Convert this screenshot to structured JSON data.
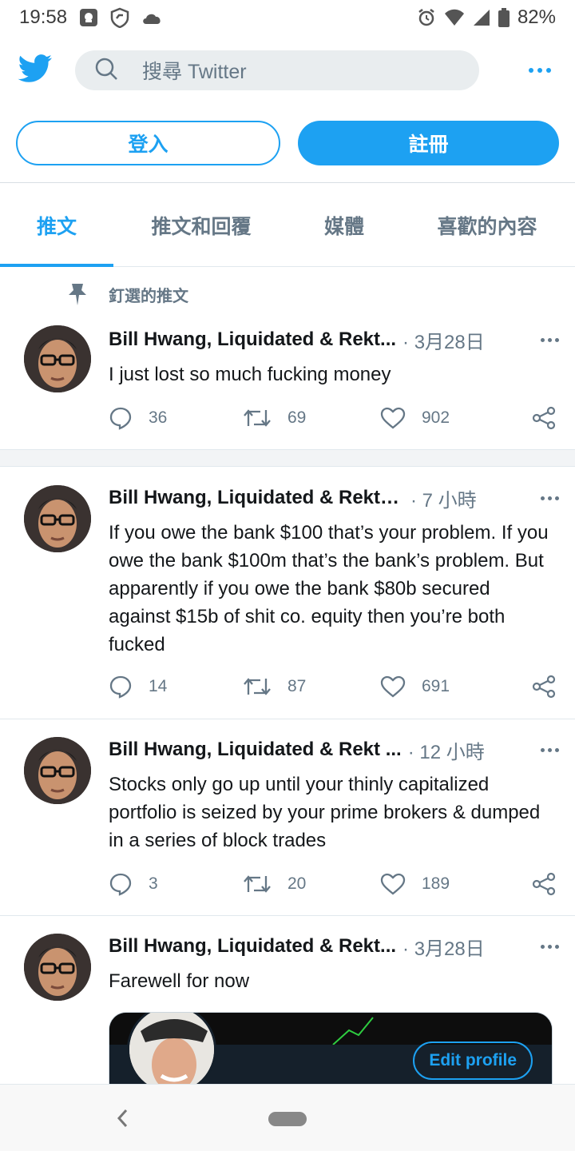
{
  "status": {
    "time": "19:58",
    "battery": "82%"
  },
  "search": {
    "placeholder": "搜尋 Twitter"
  },
  "auth": {
    "login": "登入",
    "signup": "註冊"
  },
  "tabs": [
    {
      "label": "推文",
      "active": true
    },
    {
      "label": "推文和回覆",
      "active": false
    },
    {
      "label": "媒體",
      "active": false
    },
    {
      "label": "喜歡的內容",
      "active": false
    }
  ],
  "pinned_label": "釘選的推文",
  "tweets": [
    {
      "name": "Bill Hwang, Liquidated & Rekt...",
      "time": "· 3月28日",
      "text": "I just lost so much fucking money",
      "replies": "36",
      "retweets": "69",
      "likes": "902"
    },
    {
      "name": "Bill Hwang, Liquidated & Rekt (...",
      "time": "· 7 小時",
      "text": "If you owe the bank $100 that’s your problem. If you owe the bank $100m that’s the bank’s problem. But apparently if you owe the bank $80b secured against $15b of shit co. equity then you’re both fucked",
      "replies": "14",
      "retweets": "87",
      "likes": "691"
    },
    {
      "name": "Bill Hwang, Liquidated & Rekt ...",
      "time": "· 12 小時",
      "text": "Stocks only go up until your thinly capitalized portfolio is seized by your prime brokers & dumped in a series of block trades",
      "replies": "3",
      "retweets": "20",
      "likes": "189"
    },
    {
      "name": "Bill Hwang, Liquidated & Rekt...",
      "time": "· 3月28日",
      "text": "Farewell for now",
      "card_button": "Edit profile"
    }
  ],
  "colors": {
    "accent": "#1da1f2",
    "muted": "#657786",
    "text": "#14171a"
  },
  "icons": [
    "twitter-bird-icon",
    "search-icon",
    "more-icon",
    "pin-icon",
    "reply-icon",
    "retweet-icon",
    "like-icon",
    "share-icon"
  ]
}
